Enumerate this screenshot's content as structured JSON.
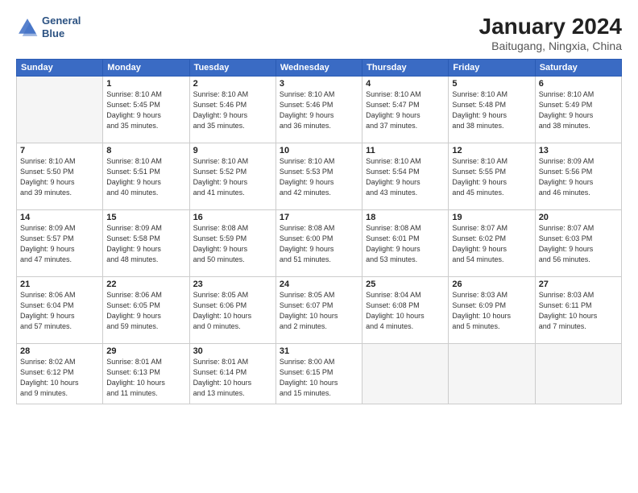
{
  "header": {
    "logo_line1": "General",
    "logo_line2": "Blue",
    "title": "January 2024",
    "location": "Baitugang, Ningxia, China"
  },
  "weekdays": [
    "Sunday",
    "Monday",
    "Tuesday",
    "Wednesday",
    "Thursday",
    "Friday",
    "Saturday"
  ],
  "weeks": [
    [
      {
        "day": "",
        "info": ""
      },
      {
        "day": "1",
        "info": "Sunrise: 8:10 AM\nSunset: 5:45 PM\nDaylight: 9 hours\nand 35 minutes."
      },
      {
        "day": "2",
        "info": "Sunrise: 8:10 AM\nSunset: 5:46 PM\nDaylight: 9 hours\nand 35 minutes."
      },
      {
        "day": "3",
        "info": "Sunrise: 8:10 AM\nSunset: 5:46 PM\nDaylight: 9 hours\nand 36 minutes."
      },
      {
        "day": "4",
        "info": "Sunrise: 8:10 AM\nSunset: 5:47 PM\nDaylight: 9 hours\nand 37 minutes."
      },
      {
        "day": "5",
        "info": "Sunrise: 8:10 AM\nSunset: 5:48 PM\nDaylight: 9 hours\nand 38 minutes."
      },
      {
        "day": "6",
        "info": "Sunrise: 8:10 AM\nSunset: 5:49 PM\nDaylight: 9 hours\nand 38 minutes."
      }
    ],
    [
      {
        "day": "7",
        "info": "Sunrise: 8:10 AM\nSunset: 5:50 PM\nDaylight: 9 hours\nand 39 minutes."
      },
      {
        "day": "8",
        "info": "Sunrise: 8:10 AM\nSunset: 5:51 PM\nDaylight: 9 hours\nand 40 minutes."
      },
      {
        "day": "9",
        "info": "Sunrise: 8:10 AM\nSunset: 5:52 PM\nDaylight: 9 hours\nand 41 minutes."
      },
      {
        "day": "10",
        "info": "Sunrise: 8:10 AM\nSunset: 5:53 PM\nDaylight: 9 hours\nand 42 minutes."
      },
      {
        "day": "11",
        "info": "Sunrise: 8:10 AM\nSunset: 5:54 PM\nDaylight: 9 hours\nand 43 minutes."
      },
      {
        "day": "12",
        "info": "Sunrise: 8:10 AM\nSunset: 5:55 PM\nDaylight: 9 hours\nand 45 minutes."
      },
      {
        "day": "13",
        "info": "Sunrise: 8:09 AM\nSunset: 5:56 PM\nDaylight: 9 hours\nand 46 minutes."
      }
    ],
    [
      {
        "day": "14",
        "info": "Sunrise: 8:09 AM\nSunset: 5:57 PM\nDaylight: 9 hours\nand 47 minutes."
      },
      {
        "day": "15",
        "info": "Sunrise: 8:09 AM\nSunset: 5:58 PM\nDaylight: 9 hours\nand 48 minutes."
      },
      {
        "day": "16",
        "info": "Sunrise: 8:08 AM\nSunset: 5:59 PM\nDaylight: 9 hours\nand 50 minutes."
      },
      {
        "day": "17",
        "info": "Sunrise: 8:08 AM\nSunset: 6:00 PM\nDaylight: 9 hours\nand 51 minutes."
      },
      {
        "day": "18",
        "info": "Sunrise: 8:08 AM\nSunset: 6:01 PM\nDaylight: 9 hours\nand 53 minutes."
      },
      {
        "day": "19",
        "info": "Sunrise: 8:07 AM\nSunset: 6:02 PM\nDaylight: 9 hours\nand 54 minutes."
      },
      {
        "day": "20",
        "info": "Sunrise: 8:07 AM\nSunset: 6:03 PM\nDaylight: 9 hours\nand 56 minutes."
      }
    ],
    [
      {
        "day": "21",
        "info": "Sunrise: 8:06 AM\nSunset: 6:04 PM\nDaylight: 9 hours\nand 57 minutes."
      },
      {
        "day": "22",
        "info": "Sunrise: 8:06 AM\nSunset: 6:05 PM\nDaylight: 9 hours\nand 59 minutes."
      },
      {
        "day": "23",
        "info": "Sunrise: 8:05 AM\nSunset: 6:06 PM\nDaylight: 10 hours\nand 0 minutes."
      },
      {
        "day": "24",
        "info": "Sunrise: 8:05 AM\nSunset: 6:07 PM\nDaylight: 10 hours\nand 2 minutes."
      },
      {
        "day": "25",
        "info": "Sunrise: 8:04 AM\nSunset: 6:08 PM\nDaylight: 10 hours\nand 4 minutes."
      },
      {
        "day": "26",
        "info": "Sunrise: 8:03 AM\nSunset: 6:09 PM\nDaylight: 10 hours\nand 5 minutes."
      },
      {
        "day": "27",
        "info": "Sunrise: 8:03 AM\nSunset: 6:11 PM\nDaylight: 10 hours\nand 7 minutes."
      }
    ],
    [
      {
        "day": "28",
        "info": "Sunrise: 8:02 AM\nSunset: 6:12 PM\nDaylight: 10 hours\nand 9 minutes."
      },
      {
        "day": "29",
        "info": "Sunrise: 8:01 AM\nSunset: 6:13 PM\nDaylight: 10 hours\nand 11 minutes."
      },
      {
        "day": "30",
        "info": "Sunrise: 8:01 AM\nSunset: 6:14 PM\nDaylight: 10 hours\nand 13 minutes."
      },
      {
        "day": "31",
        "info": "Sunrise: 8:00 AM\nSunset: 6:15 PM\nDaylight: 10 hours\nand 15 minutes."
      },
      {
        "day": "",
        "info": ""
      },
      {
        "day": "",
        "info": ""
      },
      {
        "day": "",
        "info": ""
      }
    ]
  ]
}
